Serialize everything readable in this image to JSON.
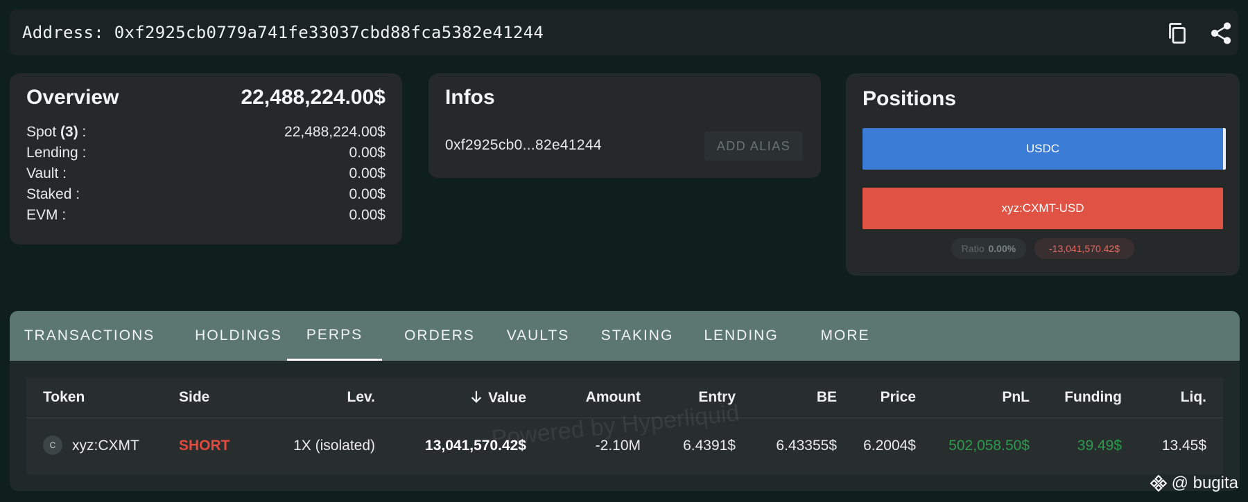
{
  "address_bar": {
    "label": "Address: 0xf2925cb0779a741fe33037cbd88fca5382e41244",
    "icons": [
      "copy-icon",
      "share-icon"
    ]
  },
  "overview": {
    "title": "Overview",
    "total": "22,488,224.00$",
    "rows": [
      {
        "label_prefix": "Spot ",
        "label_count": "(3)",
        "label_suffix": " :",
        "value": "22,488,224.00$"
      },
      {
        "label": "Lending :",
        "value": "0.00$"
      },
      {
        "label": "Vault :",
        "value": "0.00$"
      },
      {
        "label": "Staked :",
        "value": "0.00$"
      },
      {
        "label": "EVM :",
        "value": "0.00$"
      }
    ]
  },
  "infos": {
    "title": "Infos",
    "short_address": "0xf2925cb0...82e41244",
    "add_alias_label": "ADD ALIAS"
  },
  "positions": {
    "title": "Positions",
    "bars": [
      {
        "label": "USDC",
        "color": "#3a7bd5"
      },
      {
        "label": "xyz:CXMT-USD",
        "color": "#e05244"
      }
    ],
    "ratio_label": "Ratio",
    "ratio_value": "0.00%",
    "net_value": "-13,041,570.42$"
  },
  "tabs": [
    {
      "label": "TRANSACTIONS"
    },
    {
      "label": "HOLDINGS"
    },
    {
      "label": "PERPS",
      "active": true
    },
    {
      "label": "ORDERS"
    },
    {
      "label": "VAULTS"
    },
    {
      "label": "STAKING"
    },
    {
      "label": "LENDING"
    },
    {
      "label": "MORE"
    }
  ],
  "perps_table": {
    "columns": [
      "Token",
      "Side",
      "Lev.",
      "Value",
      "Amount",
      "Entry",
      "BE",
      "Price",
      "PnL",
      "Funding",
      "Liq."
    ],
    "sorted_column": "Value",
    "rows": [
      {
        "token_initial": "C",
        "token": "xyz:CXMT",
        "side": "SHORT",
        "lev": "1X (isolated)",
        "value": "13,041,570.42$",
        "amount": "-2.10M",
        "entry": "6.4391$",
        "be": "6.43355$",
        "price": "6.2004$",
        "pnl": "502,058.50$",
        "funding": "39.49$",
        "liq": "13.45$"
      }
    ]
  },
  "watermark": "Powered by Hyperliquid",
  "credit": "@ bugita"
}
